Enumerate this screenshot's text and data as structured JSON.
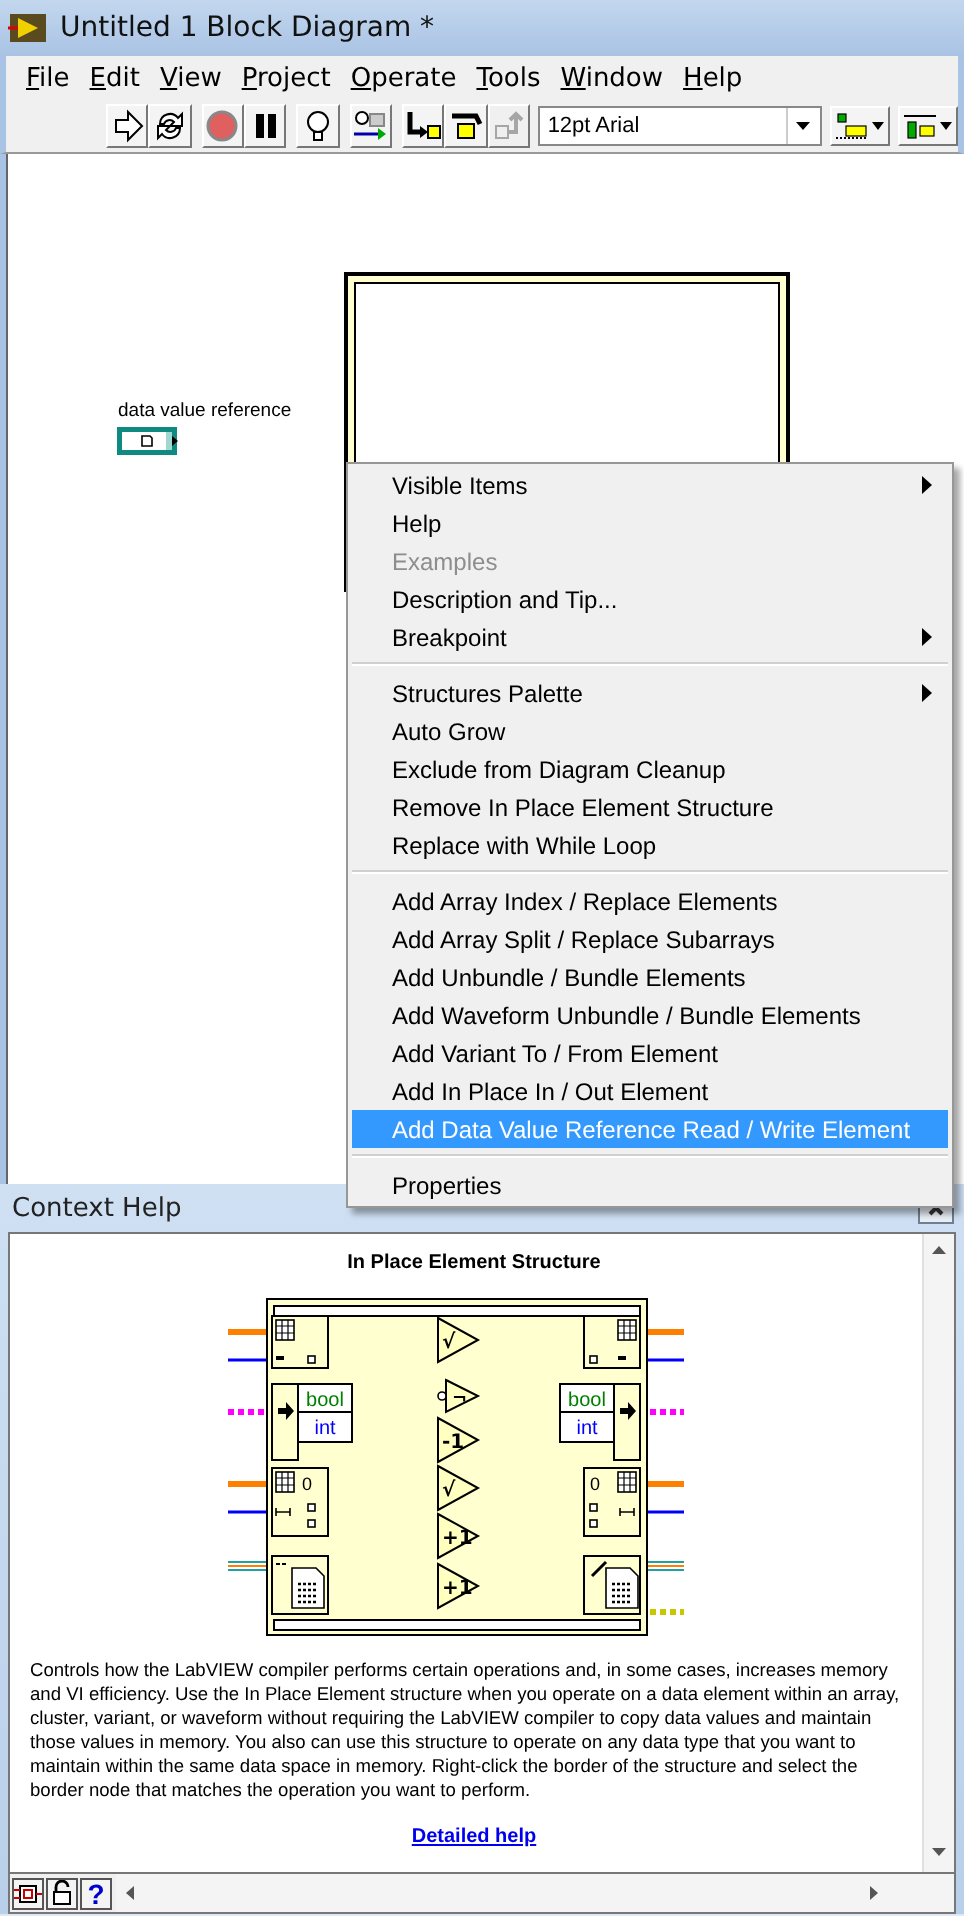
{
  "window": {
    "title": "Untitled 1 Block Diagram *"
  },
  "menu_bar": [
    {
      "label": "File"
    },
    {
      "label": "Edit"
    },
    {
      "label": "View"
    },
    {
      "label": "Project"
    },
    {
      "label": "Operate"
    },
    {
      "label": "Tools"
    },
    {
      "label": "Window"
    },
    {
      "label": "Help"
    }
  ],
  "toolbar": {
    "buttons": [
      {
        "kind": "run",
        "disabled": false
      },
      {
        "kind": "run-continuously",
        "disabled": false
      },
      {
        "kind": "abort",
        "disabled": false
      },
      {
        "kind": "pause",
        "disabled": false
      },
      {
        "kind": "highlight",
        "disabled": false
      },
      {
        "kind": "retain-wire-values",
        "disabled": false
      },
      {
        "kind": "step-into",
        "disabled": false
      },
      {
        "kind": "step-over",
        "disabled": false
      },
      {
        "kind": "step-out",
        "disabled": true
      }
    ],
    "font_selector": {
      "value": "12pt Arial"
    },
    "dropdowns": [
      {
        "kind": "align"
      },
      {
        "kind": "distribute"
      }
    ]
  },
  "block_diagram": {
    "terminal": {
      "label": "data value reference"
    }
  },
  "context_menu": {
    "groups": [
      [
        {
          "label": "Visible Items",
          "submenu": true,
          "disabled": false,
          "selected": false
        },
        {
          "label": "Help",
          "submenu": false,
          "disabled": false,
          "selected": false
        },
        {
          "label": "Examples",
          "submenu": false,
          "disabled": true,
          "selected": false
        },
        {
          "label": "Description and Tip...",
          "submenu": false,
          "disabled": false,
          "selected": false
        },
        {
          "label": "Breakpoint",
          "submenu": true,
          "disabled": false,
          "selected": false
        }
      ],
      [
        {
          "label": "Structures Palette",
          "submenu": true,
          "disabled": false,
          "selected": false
        },
        {
          "label": "Auto Grow",
          "submenu": false,
          "disabled": false,
          "selected": false
        },
        {
          "label": "Exclude from Diagram Cleanup",
          "submenu": false,
          "disabled": false,
          "selected": false
        },
        {
          "label": "Remove In Place Element Structure",
          "submenu": false,
          "disabled": false,
          "selected": false
        },
        {
          "label": "Replace with While Loop",
          "submenu": false,
          "disabled": false,
          "selected": false
        }
      ],
      [
        {
          "label": "Add Array Index / Replace Elements",
          "submenu": false,
          "disabled": false,
          "selected": false
        },
        {
          "label": "Add Array Split / Replace Subarrays",
          "submenu": false,
          "disabled": false,
          "selected": false
        },
        {
          "label": "Add Unbundle / Bundle Elements",
          "submenu": false,
          "disabled": false,
          "selected": false
        },
        {
          "label": "Add Waveform Unbundle / Bundle Elements",
          "submenu": false,
          "disabled": false,
          "selected": false
        },
        {
          "label": "Add Variant To / From Element",
          "submenu": false,
          "disabled": false,
          "selected": false
        },
        {
          "label": "Add In Place In / Out Element",
          "submenu": false,
          "disabled": false,
          "selected": false
        },
        {
          "label": "Add Data Value Reference Read / Write Element",
          "submenu": false,
          "disabled": false,
          "selected": true
        }
      ],
      [
        {
          "label": "Properties",
          "submenu": false,
          "disabled": false,
          "selected": false
        }
      ]
    ]
  },
  "context_help": {
    "title": "Context Help",
    "heading": "In Place Element Structure",
    "diagram": {
      "cluster_fields": [
        "bool",
        "int",
        "bool",
        "int"
      ],
      "index_labels": [
        "0",
        "0"
      ],
      "operations": [
        "√",
        "¬",
        "-1",
        "√",
        "+1",
        "+1"
      ]
    },
    "description": "Controls how the LabVIEW compiler performs certain operations and, in some cases, increases memory and VI efficiency. Use the In Place Element structure when you operate on a data element within an array, cluster, variant, or waveform without requiring the LabVIEW compiler to copy data values and maintain those values in memory. You also can use this structure to operate on any data type that you want to maintain within the same data space in memory. Right-click the border of the structure and select the border node that matches the operation you want to perform.",
    "link": "Detailed help",
    "bottom_buttons": [
      {
        "kind": "terminals"
      },
      {
        "kind": "lock"
      },
      {
        "kind": "help",
        "glyph": "?"
      }
    ]
  }
}
